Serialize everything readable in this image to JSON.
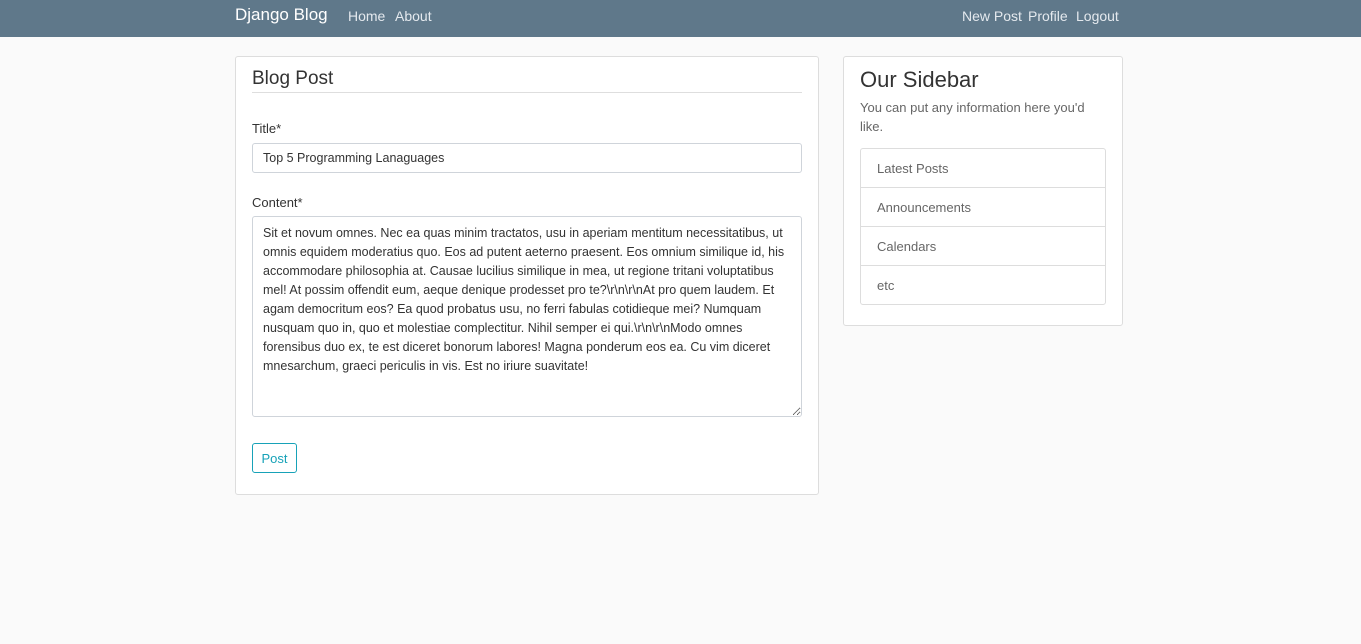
{
  "navbar": {
    "brand": "Django Blog",
    "left_links": [
      "Home",
      "About"
    ],
    "right_links": [
      "New Post",
      "Profile",
      "Logout"
    ]
  },
  "form": {
    "legend": "Blog Post",
    "title_label": "Title*",
    "title_value": "Top 5 Programming Lanaguages",
    "content_label": "Content*",
    "content_value": "Sit et novum omnes. Nec ea quas minim tractatos, usu in aperiam mentitum necessitatibus, ut omnis equidem moderatius quo. Eos ad putent aeterno praesent. Eos omnium similique id, his accommodare philosophia at. Causae lucilius similique in mea, ut regione tritani voluptatibus mel! At possim offendit eum, aeque denique prodesset pro te?\\r\\n\\r\\nAt pro quem laudem. Et agam democritum eos? Ea quod probatus usu, no ferri fabulas cotidieque mei? Numquam nusquam quo in, quo et molestiae complectitur. Nihil semper ei qui.\\r\\n\\r\\nModo omnes forensibus duo ex, te est diceret bonorum labores! Magna ponderum eos ea. Cu vim diceret mnesarchum, graeci periculis in vis. Est no iriure suavitate!",
    "submit_label": "Post"
  },
  "sidebar": {
    "title": "Our Sidebar",
    "text": "You can put any information here you'd like.",
    "items": [
      "Latest Posts",
      "Announcements",
      "Calendars",
      "etc"
    ]
  },
  "colors": {
    "navbar": "#5f788a",
    "accent": "#17a2b8",
    "background": "#fafafa"
  }
}
